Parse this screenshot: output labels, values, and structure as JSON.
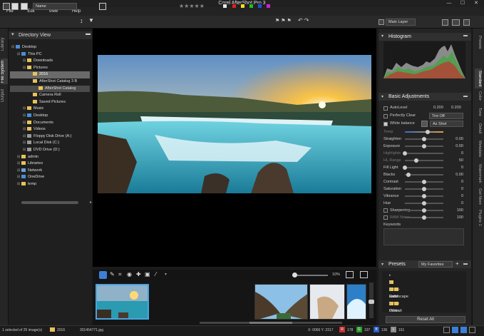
{
  "window": {
    "title": "Corel AfterShot Pro 3",
    "minimize": "—",
    "maximize": "☐",
    "close": "✕"
  },
  "menu": [
    "File",
    "Edit",
    "View",
    "Help"
  ],
  "toolbar": {
    "sort_select": "Name",
    "layer_select": "Main Layer",
    "stars": "★★★★★",
    "swatches": [
      "#e8e8e8",
      "#e02020",
      "#f0e020",
      "#20c020",
      "#2050e0",
      "#d020d0"
    ],
    "flags": "⚑ ⚑ ⚑",
    "rotate": "↶ ↷"
  },
  "left_tabs": [
    "Library",
    "File System",
    "Output"
  ],
  "directory": {
    "title": "Directory View",
    "items": [
      {
        "label": "Desktop",
        "indent": 0,
        "icon": "blue"
      },
      {
        "label": "This PC",
        "indent": 1,
        "icon": "blue"
      },
      {
        "label": "Downloads",
        "indent": 2,
        "icon": "yellow"
      },
      {
        "label": "Pictures",
        "indent": 2,
        "icon": "yellow"
      },
      {
        "label": "2016",
        "indent": 3,
        "icon": "yellow"
      },
      {
        "label": "AfterShot Catalog 3 B",
        "indent": 3,
        "icon": "yellow"
      },
      {
        "label": "AfterShot Catalog",
        "indent": 4,
        "icon": "yellow"
      },
      {
        "label": "Camera Roll",
        "indent": 3,
        "icon": "yellow"
      },
      {
        "label": "Saved Pictures",
        "indent": 3,
        "icon": "yellow"
      },
      {
        "label": "Music",
        "indent": 2,
        "icon": "yellow"
      },
      {
        "label": "Desktop",
        "indent": 2,
        "icon": "blue"
      },
      {
        "label": "Documents",
        "indent": 2,
        "icon": "yellow"
      },
      {
        "label": "Videos",
        "indent": 2,
        "icon": "yellow"
      },
      {
        "label": "Floppy Disk Drive (A:)",
        "indent": 2,
        "icon": "gray"
      },
      {
        "label": "Local Disk (C:)",
        "indent": 2,
        "icon": "gray"
      },
      {
        "label": "DVD Drive (D:)",
        "indent": 2,
        "icon": "gray"
      },
      {
        "label": "admin",
        "indent": 1,
        "icon": "yellow"
      },
      {
        "label": "Libraries",
        "indent": 1,
        "icon": "yellow"
      },
      {
        "label": "Network",
        "indent": 1,
        "icon": "net"
      },
      {
        "label": "OneDrive",
        "indent": 1,
        "icon": "blue"
      },
      {
        "label": "temp",
        "indent": 1,
        "icon": "yellow"
      }
    ]
  },
  "image_tools": {
    "zoom_value": "10%"
  },
  "status": {
    "selection": "1 selected of 25 image(s)",
    "folder": "2016",
    "filename": "301454771.jpg",
    "coords": "X: 0066  Y: 2317",
    "r_label": "R",
    "r_value": "178",
    "g_label": "G",
    "g_value": "197",
    "b_label": "B",
    "b_value": "136",
    "l_label": "L",
    "l_value": "161"
  },
  "histogram": {
    "title": "Histogram"
  },
  "basic": {
    "title": "Basic Adjustments",
    "autolevel": {
      "label": "AutoLevel",
      "v1": "0.200",
      "v2": "0.200"
    },
    "perfectly_clear": {
      "label": "Perfectly Clear",
      "option": "Tint Off"
    },
    "white_balance": {
      "label": "White balance",
      "option": "As Shot"
    },
    "rows": [
      {
        "label": "Temp",
        "pos": 0.6,
        "value": ""
      },
      {
        "label": "Straighten",
        "pos": 0.5,
        "value": "0.00"
      },
      {
        "label": "Exposure",
        "pos": 0.5,
        "value": "0.00"
      },
      {
        "label": "Highlights",
        "pos": 0.0,
        "value": "0"
      },
      {
        "label": "HL Range",
        "pos": 0.3,
        "value": "50"
      },
      {
        "label": "Fill Light",
        "pos": 0.0,
        "value": "0"
      },
      {
        "label": "Blacks",
        "pos": 0.1,
        "value": "0.00"
      },
      {
        "label": "Contrast",
        "pos": 0.5,
        "value": "0"
      },
      {
        "label": "Saturation",
        "pos": 0.5,
        "value": "0"
      },
      {
        "label": "Vibrance",
        "pos": 0.5,
        "value": "0"
      },
      {
        "label": "Hue",
        "pos": 0.5,
        "value": "0"
      },
      {
        "label": "Sharpening",
        "pos": 0.5,
        "value": "100"
      },
      {
        "label": "RAW Noise",
        "pos": 0.5,
        "value": "100"
      }
    ],
    "keywords": "Keywords"
  },
  "presets": {
    "title": "Presets",
    "filter": "My Favorites",
    "items": [
      "Black-and-White",
      "Color",
      "Landscape",
      "Other",
      "Portrait"
    ],
    "reset": "Reset All"
  },
  "right_tabs": [
    "Presets",
    "Standard",
    "Color",
    "Tone",
    "Detail",
    "Metadata",
    "Watermark",
    "Get More",
    "Plugins 1"
  ]
}
